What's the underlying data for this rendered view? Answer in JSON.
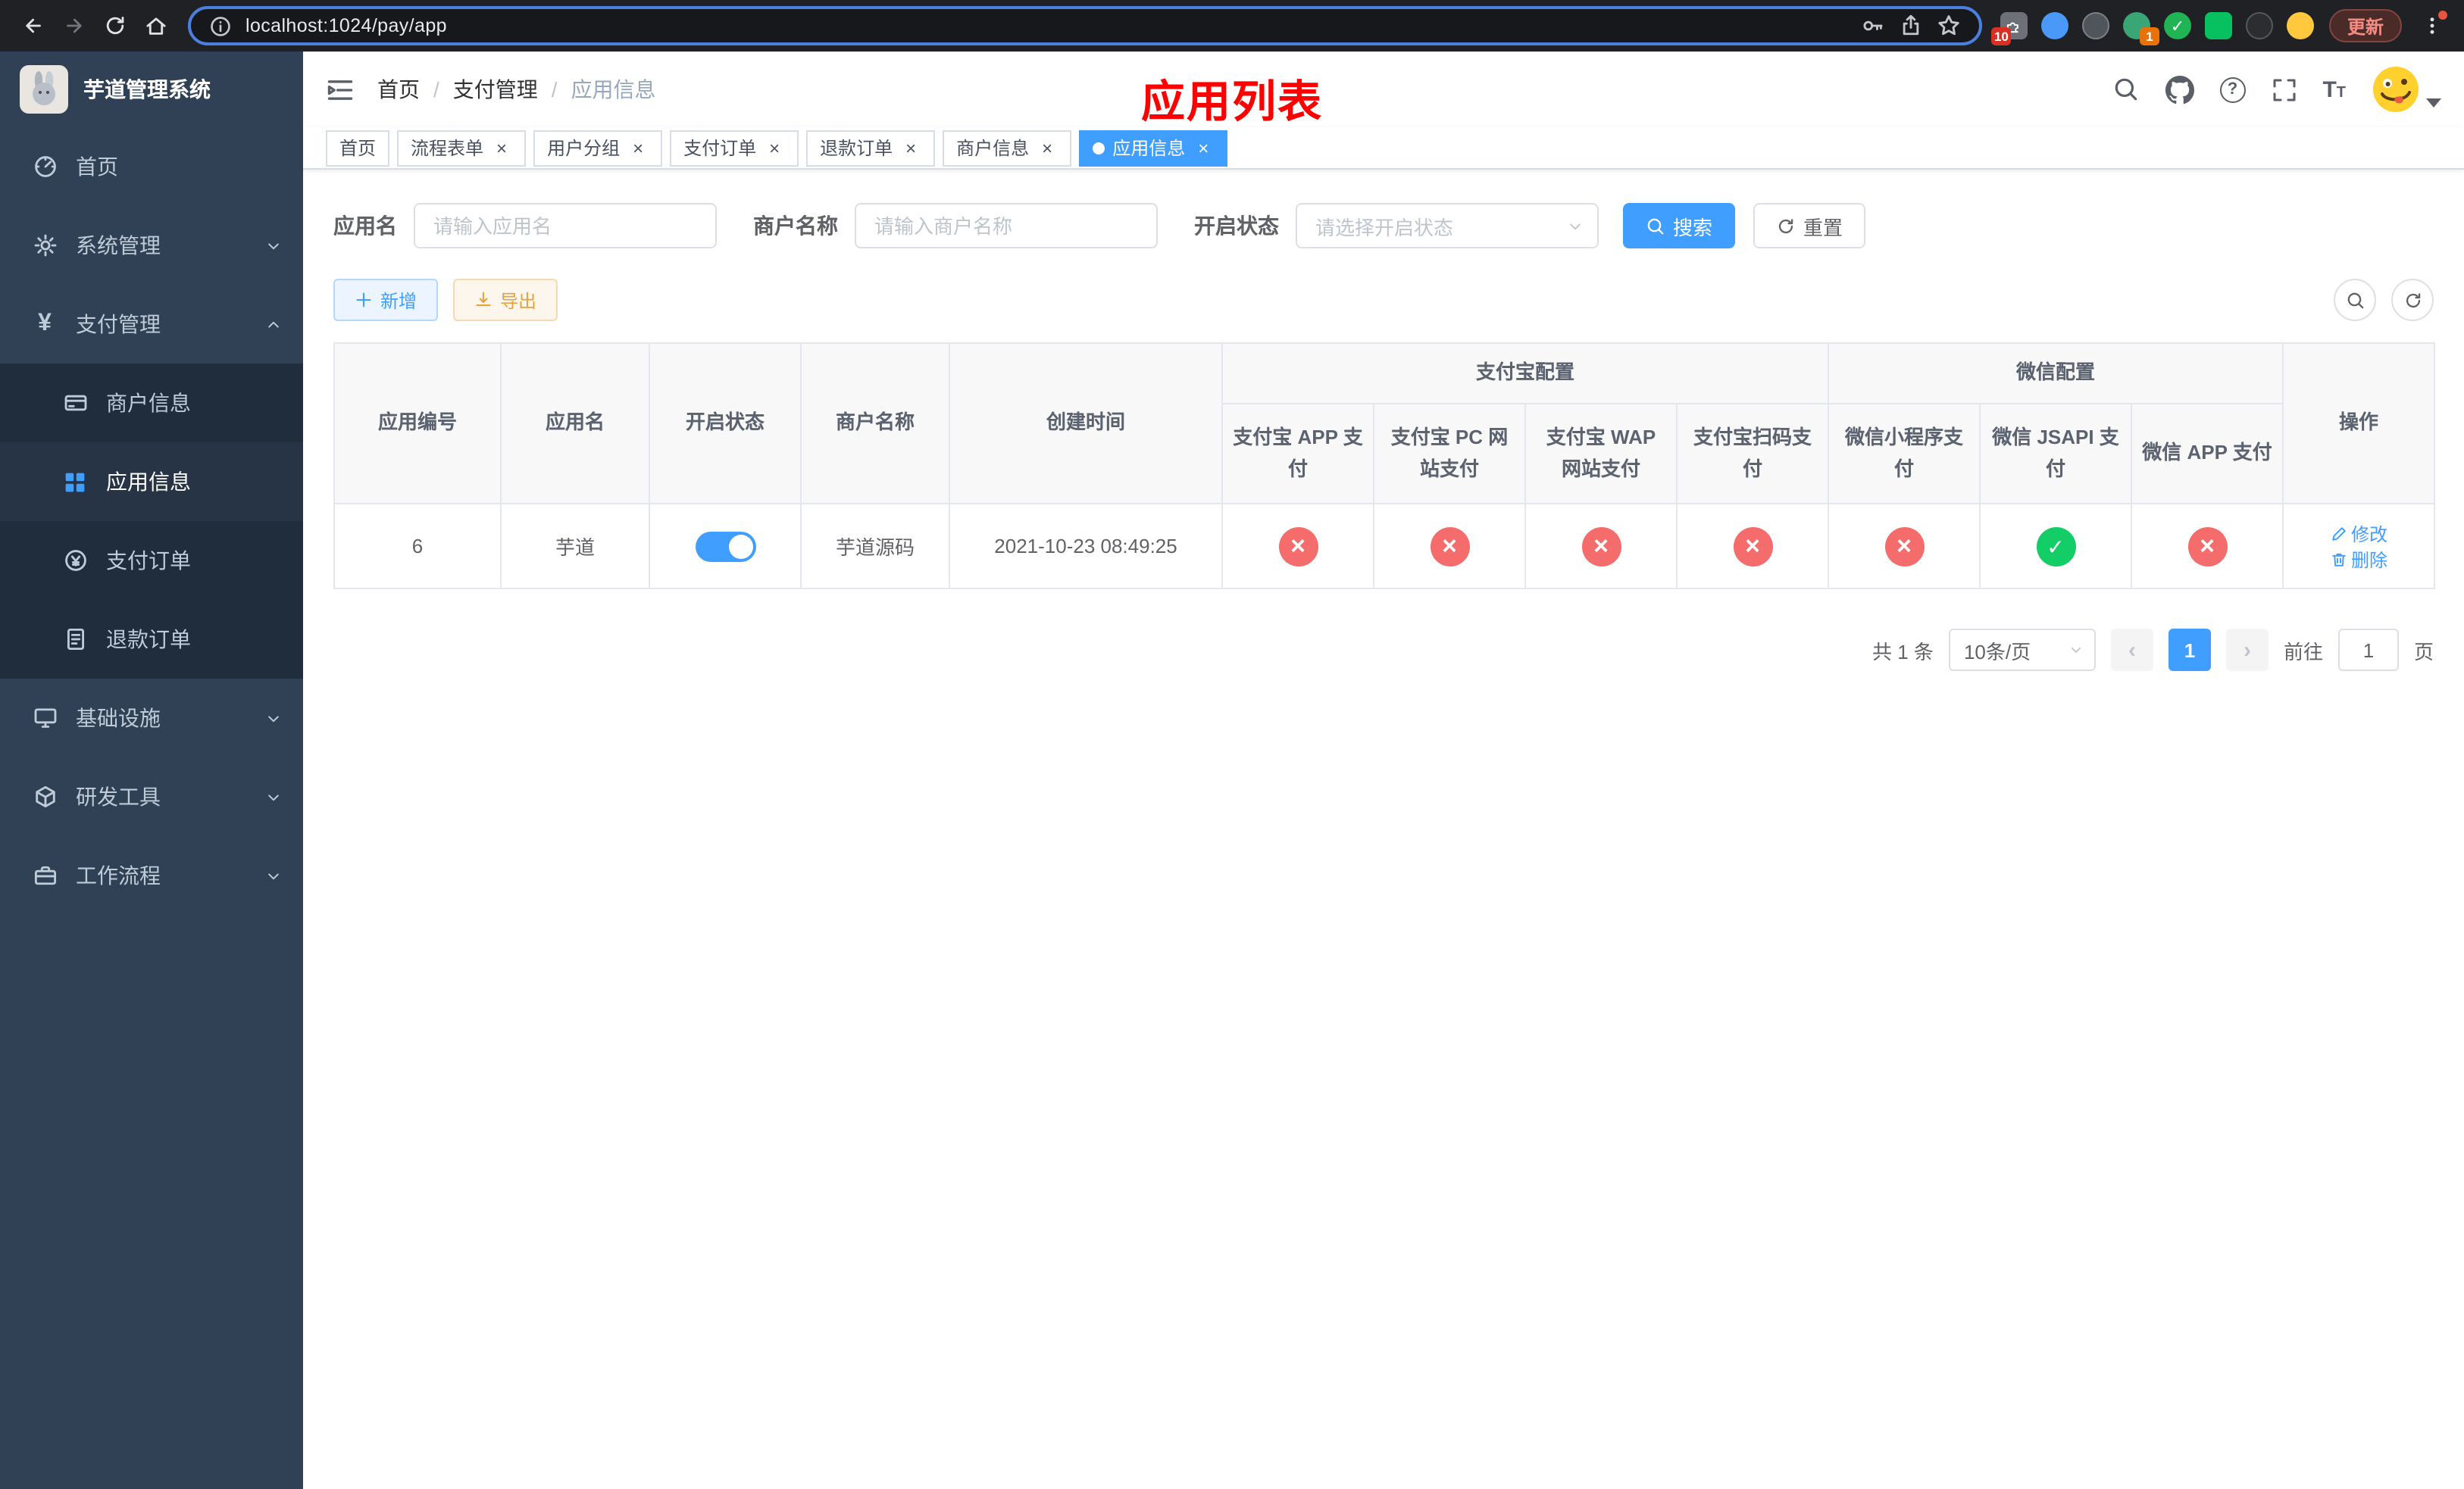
{
  "colors": {
    "primary": "#409eff",
    "danger": "#f56c6c",
    "success": "#13ce66",
    "warning": "#e6a23c",
    "title_red": "#ff0000",
    "sidebar_bg": "#304156",
    "submenu_bg": "#1f2d3d"
  },
  "browser": {
    "url": "localhost:1024/pay/app",
    "update_label": "更新",
    "ext_badges": {
      "puzzle": "10",
      "green_avatar": "1"
    }
  },
  "sidebar": {
    "app_title": "芋道管理系统",
    "items": {
      "home": "首页",
      "system": "系统管理",
      "pay": "支付管理",
      "merchant": "商户信息",
      "app_info": "应用信息",
      "pay_order": "支付订单",
      "refund_order": "退款订单",
      "infra": "基础设施",
      "dev_tools": "研发工具",
      "workflow": "工作流程"
    }
  },
  "navbar": {
    "breadcrumb": {
      "home": "首页",
      "section": "支付管理",
      "current": "应用信息"
    },
    "page_title": "应用列表"
  },
  "tabs": [
    {
      "label": "首页",
      "closable": false,
      "active": false
    },
    {
      "label": "流程表单",
      "closable": true,
      "active": false
    },
    {
      "label": "用户分组",
      "closable": true,
      "active": false
    },
    {
      "label": "支付订单",
      "closable": true,
      "active": false
    },
    {
      "label": "退款订单",
      "closable": true,
      "active": false
    },
    {
      "label": "商户信息",
      "closable": true,
      "active": false
    },
    {
      "label": "应用信息",
      "closable": true,
      "active": true
    }
  ],
  "filters": {
    "app_name_label": "应用名",
    "app_name_placeholder": "请输入应用名",
    "merchant_label": "商户名称",
    "merchant_placeholder": "请输入商户名称",
    "status_label": "开启状态",
    "status_placeholder": "请选择开启状态",
    "search_button": "搜索",
    "reset_button": "重置"
  },
  "toolbar": {
    "add_label": "新增",
    "export_label": "导出"
  },
  "table": {
    "groups": {
      "alipay": "支付宝配置",
      "wechat": "微信配置"
    },
    "columns": {
      "id": "应用编号",
      "name": "应用名",
      "status": "开启状态",
      "merchant": "商户名称",
      "created": "创建时间",
      "alipay_app": "支付宝 APP 支付",
      "alipay_pc": "支付宝 PC 网站支付",
      "alipay_wap": "支付宝 WAP 网站支付",
      "alipay_scan": "支付宝扫码支付",
      "wx_lite": "微信小程序支付",
      "wx_jsapi": "微信 JSAPI 支付",
      "wx_app": "微信 APP 支付",
      "actions": "操作"
    },
    "rows": [
      {
        "id": "6",
        "name": "芋道",
        "status_on": true,
        "merchant": "芋道源码",
        "created": "2021-10-23 08:49:25",
        "alipay_app": false,
        "alipay_pc": false,
        "alipay_wap": false,
        "alipay_scan": false,
        "wx_lite": false,
        "wx_jsapi": true,
        "wx_app": false,
        "edit_label": "修改",
        "delete_label": "删除"
      }
    ]
  },
  "pagination": {
    "total": "共 1 条",
    "page_size": "10条/页",
    "current_page": "1",
    "goto_label": "前往",
    "goto_value": "1",
    "page_label": "页"
  }
}
